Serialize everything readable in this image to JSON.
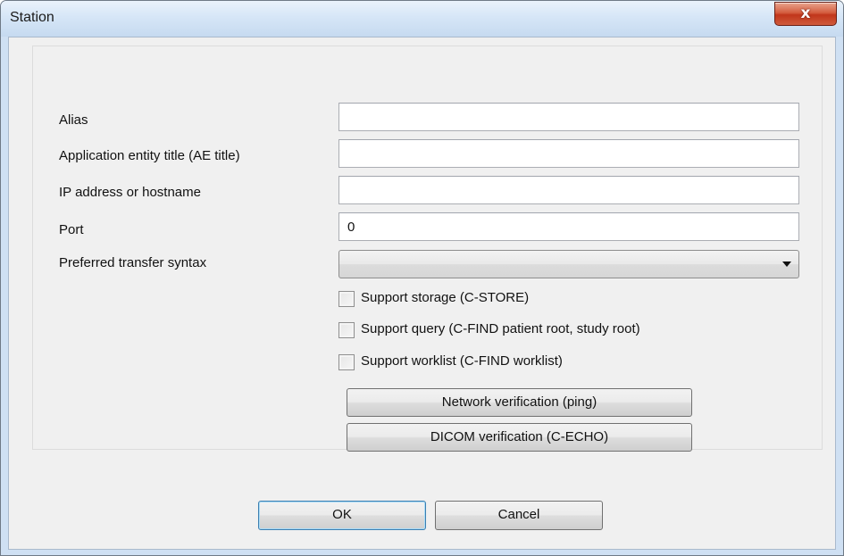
{
  "window": {
    "title": "Station",
    "close_label": "x"
  },
  "form": {
    "alias": {
      "label": "Alias",
      "value": ""
    },
    "ae_title": {
      "label": "Application entity title (AE title)",
      "value": ""
    },
    "ip": {
      "label": "IP address or hostname",
      "value": ""
    },
    "port": {
      "label": "Port",
      "value": "0"
    },
    "transfer_syntax": {
      "label": "Preferred transfer syntax",
      "value": ""
    }
  },
  "checkboxes": {
    "storage": {
      "label": "Support storage (C-STORE)",
      "checked": false
    },
    "query": {
      "label": "Support query (C-FIND patient root, study root)",
      "checked": false
    },
    "worklist": {
      "label": "Support worklist (C-FIND worklist)",
      "checked": false
    }
  },
  "buttons": {
    "network_verification": "Network verification (ping)",
    "dicom_verification": "DICOM verification (C-ECHO)",
    "ok": "OK",
    "cancel": "Cancel"
  },
  "colors": {
    "titlebar": "#d6e6f7",
    "close_button": "#c1361b",
    "client_background": "#f0f0f0",
    "default_button_border": "#3c7fb1"
  },
  "icons": {
    "close": "close-icon",
    "dropdown": "chevron-down-icon"
  }
}
